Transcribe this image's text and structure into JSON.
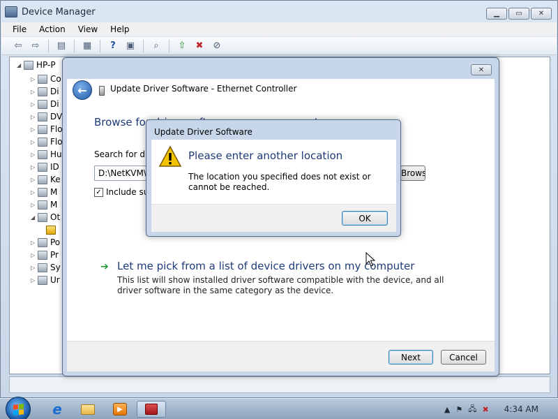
{
  "device_manager": {
    "title": "Device Manager",
    "menu": [
      "File",
      "Action",
      "View",
      "Help"
    ],
    "root": "HP-P",
    "tree_items": [
      "Co",
      "Di",
      "Di",
      "DV",
      "Flo",
      "Flo",
      "Hu",
      "ID",
      "Ke",
      "M",
      "M",
      "Ot",
      "",
      "Po",
      "Pr",
      "Sy",
      "Ur"
    ]
  },
  "wizard": {
    "title": "Update Driver Software - Ethernet Controller",
    "heading": "Browse for driver software on your computer",
    "search_label": "Search for driver software in this location:",
    "path_value": "D:\\NetKVM\\{",
    "browse_label": "Browse...",
    "include_subfolders": "Include subfolders",
    "pick_title": "Let me pick from a list of device drivers on my computer",
    "pick_desc": "This list will show installed driver software compatible with the device, and all driver software in the same category as the device.",
    "next_label": "Next",
    "cancel_label": "Cancel"
  },
  "message_box": {
    "title": "Update Driver Software",
    "heading": "Please enter another location",
    "text": "The location you specified does not exist or cannot be reached.",
    "ok_label": "OK"
  },
  "taskbar": {
    "clock": "4:34 AM"
  },
  "colors": {
    "heading_blue": "#1e3b78",
    "window_frame": "#c7d6e8",
    "taskbar": "#9fb3c8"
  }
}
